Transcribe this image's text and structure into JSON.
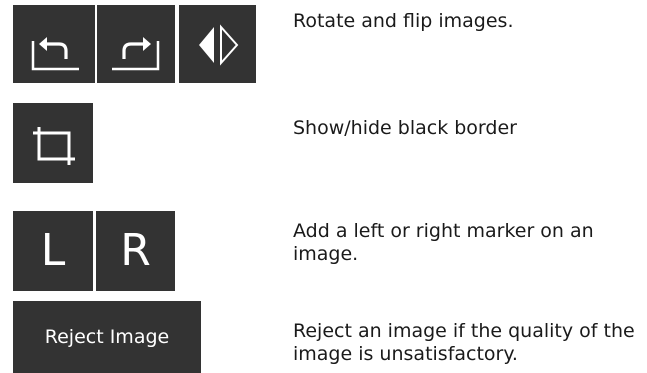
{
  "rows": [
    {
      "description": "Rotate and flip images.",
      "buttons": [
        {
          "icon": "rotate-left-icon"
        },
        {
          "icon": "rotate-right-icon"
        },
        {
          "icon": "flip-icon"
        }
      ]
    },
    {
      "description": "Show/hide black border",
      "buttons": [
        {
          "icon": "crop-icon"
        }
      ]
    },
    {
      "description": "Add a left or right marker on an image.",
      "buttons": [
        {
          "label": "L"
        },
        {
          "label": "R"
        }
      ]
    },
    {
      "description": "Reject an image if the quality of the image is unsatisfactory.",
      "buttons": [
        {
          "label": "Reject Image"
        }
      ]
    }
  ],
  "colors": {
    "button_bg": "#333333",
    "icon": "#ffffff",
    "text": "#1a1a1a"
  }
}
